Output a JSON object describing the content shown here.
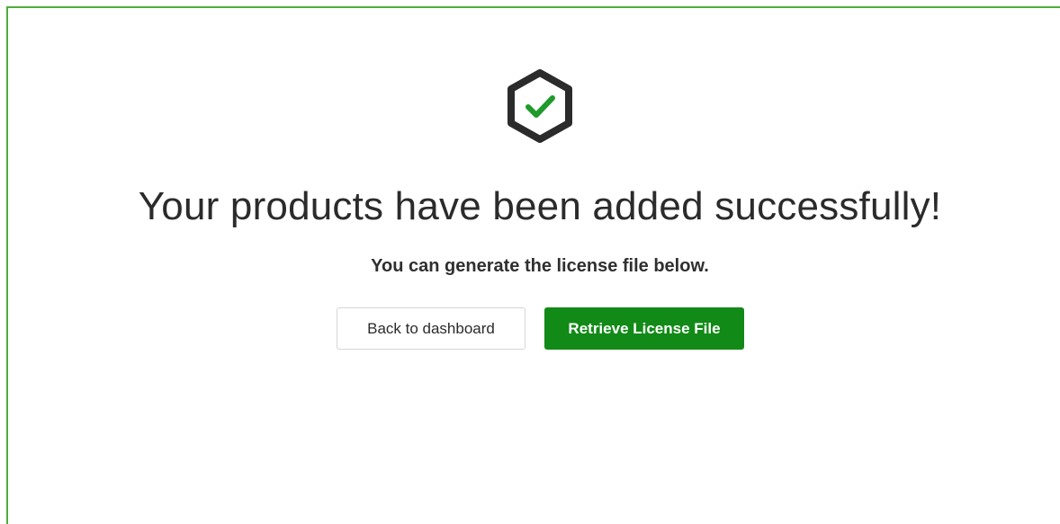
{
  "page": {
    "title": "Your products have been added successfully!",
    "subtitle": "You can generate the license file below."
  },
  "actions": {
    "back_label": "Back to dashboard",
    "retrieve_label": "Retrieve License File"
  },
  "icons": {
    "status": "success-check-hexagon-icon"
  },
  "colors": {
    "accent_green": "#128a17",
    "frame_border": "#4fae3a",
    "check_green": "#1f9a2b",
    "icon_dark": "#2b2b2b"
  }
}
